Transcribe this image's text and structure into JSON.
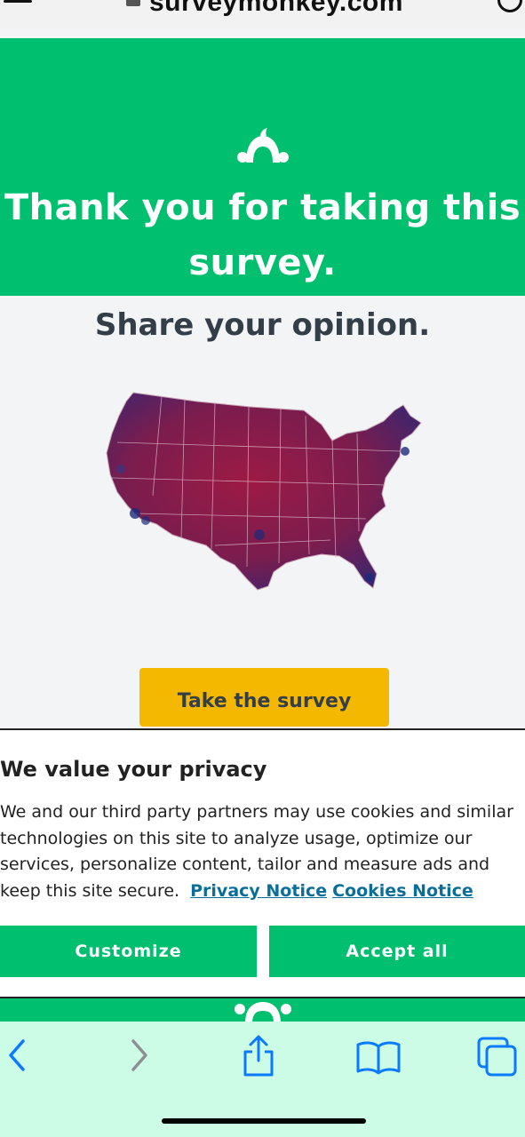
{
  "browser": {
    "url": "surveymonkey.com"
  },
  "hero": {
    "title_line1": "Thank you for taking this",
    "title_line2": "survey."
  },
  "main": {
    "heading": "Share your opinion.",
    "cta_label": "Take the survey"
  },
  "cookie_banner": {
    "title": "We value your privacy",
    "body": "We and our third party partners may use cookies and similar technologies on this site to analyze usage, optimize our services, personalize content, tailor and measure ads and keep this site secure.",
    "privacy_link": "Privacy Notice",
    "cookies_link": "Cookies Notice",
    "customize_label": "Customize",
    "accept_label": "Accept all"
  },
  "toolbar": {
    "items": [
      "back-icon",
      "forward-icon",
      "share-icon",
      "bookmarks-icon",
      "tabs-icon"
    ]
  },
  "colors": {
    "brand_green": "#00bf6f",
    "cta_yellow": "#f5b800",
    "link_blue": "#0b6e99",
    "toolbar_bg": "#ccfce6",
    "map_red": "#a5163e",
    "map_blue": "#2a2a7a"
  }
}
